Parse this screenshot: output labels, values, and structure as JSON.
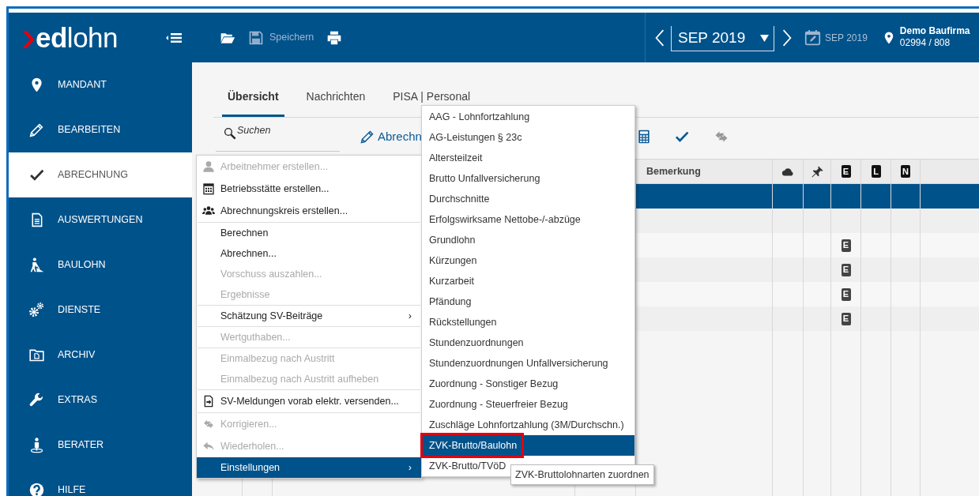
{
  "app": {
    "logo": "**ed**lohn"
  },
  "toolbar": [
    {
      "disabled": false
    },
    {
      "label": "Speichern",
      "disabled": true
    },
    {
      "disabled": false
    }
  ],
  "period": {
    "month": "SEP 2019",
    "booked": "SEP 2019"
  },
  "client": {
    "name": "Demo Baufirma",
    "number": "02994 / 808"
  },
  "sidebar": {
    "items": [
      {
        "label": "MANDANT",
        "selected": false
      },
      {
        "label": "BEARBEITEN",
        "selected": false
      },
      {
        "label": "ABRECHNUNG",
        "selected": true
      },
      {
        "label": "AUSWERTUNGEN",
        "selected": false
      },
      {
        "label": "BAULOHN",
        "selected": false
      },
      {
        "label": "DIENSTE",
        "selected": false
      },
      {
        "label": "ARCHIV",
        "selected": false
      },
      {
        "label": "EXTRAS",
        "selected": false
      },
      {
        "label": "BERATER",
        "selected": false
      },
      {
        "label": "HILFE",
        "selected": false
      }
    ]
  },
  "tabs": [
    {
      "label": "Übersicht",
      "selected": true
    },
    {
      "label": "Nachrichten",
      "selected": false
    },
    {
      "label": "PISA | Personal",
      "selected": false
    }
  ],
  "search": {
    "placeholder": "Suchen"
  },
  "actions": [
    {
      "label": "Abrechn",
      "disabled": false
    },
    {
      "disabled": false
    },
    {
      "disabled": false
    },
    {
      "disabled": true
    }
  ],
  "table": {
    "columns": [
      {
        "kind": "text",
        "label": "Bemerkung"
      },
      {
        "kind": "icon"
      },
      {
        "kind": "icon"
      },
      {
        "kind": "badge",
        "label": "E"
      },
      {
        "kind": "badge",
        "label": "L"
      },
      {
        "kind": "badge",
        "label": "N"
      }
    ],
    "rows": [
      {
        "selected": true
      },
      {
        "selected": false
      },
      {
        "selected": false,
        "badge": "E"
      },
      {
        "selected": false,
        "badge": "E"
      },
      {
        "selected": false,
        "badge": "E"
      },
      {
        "selected": false,
        "badge": "E"
      }
    ]
  },
  "context_menu": {
    "groups": [
      [
        {
          "label": "Arbeitnehmer erstellen...",
          "disabled": true,
          "selected": false
        },
        {
          "label": "Betriebsstätte erstellen...",
          "disabled": false,
          "selected": false
        },
        {
          "label": "Abrechnungskreis erstellen...",
          "disabled": false,
          "selected": false
        }
      ],
      [
        {
          "label": "Berechnen",
          "disabled": false,
          "selected": false
        },
        {
          "label": "Abrechnen...",
          "disabled": false,
          "selected": false
        },
        {
          "label": "Vorschuss auszahlen...",
          "disabled": true,
          "selected": false
        },
        {
          "label": "Ergebnisse",
          "disabled": true,
          "selected": false
        }
      ],
      [
        {
          "label": "Schätzung SV-Beiträge",
          "disabled": false,
          "selected": false,
          "arrow": "›"
        }
      ],
      [
        {
          "label": "Wertguthaben...",
          "disabled": true,
          "selected": false
        }
      ],
      [
        {
          "label": "Einmalbezug nach Austritt",
          "disabled": true,
          "selected": false
        },
        {
          "label": "Einmalbezug nach Austritt aufheben",
          "disabled": true,
          "selected": false
        }
      ],
      [
        {
          "label": "SV-Meldungen vorab elektr. versenden...",
          "disabled": false,
          "selected": false
        }
      ],
      [
        {
          "label": "Korrigieren...",
          "disabled": true,
          "selected": false
        },
        {
          "label": "Wiederholen...",
          "disabled": true,
          "selected": false
        },
        {
          "label": "Einstellungen",
          "disabled": false,
          "selected": true,
          "arrow": "›"
        }
      ]
    ]
  },
  "submenu": {
    "items": [
      {
        "label": "AAG - Lohnfortzahlung",
        "selected": false
      },
      {
        "label": "AG-Leistungen § 23c",
        "selected": false
      },
      {
        "label": "Altersteilzeit",
        "selected": false
      },
      {
        "label": "Brutto Unfallversicherung",
        "selected": false
      },
      {
        "label": "Durchschnitte",
        "selected": false
      },
      {
        "label": "Erfolgswirksame Nettobe-/-abzüge",
        "selected": false
      },
      {
        "label": "Grundlohn",
        "selected": false
      },
      {
        "label": "Kürzungen",
        "selected": false
      },
      {
        "label": "Kurzarbeit",
        "selected": false
      },
      {
        "label": "Pfändung",
        "selected": false
      },
      {
        "label": "Rückstellungen",
        "selected": false
      },
      {
        "label": "Stundenzuordnungen",
        "selected": false
      },
      {
        "label": "Stundenzuordnungen Unfallversicherung",
        "selected": false
      },
      {
        "label": "Zuordnung - Sonstiger Bezug",
        "selected": false
      },
      {
        "label": "Zuordnung - Steuerfreier Bezug",
        "selected": false
      },
      {
        "label": "Zuschläge Lohnfortzahlung (3M/Durchschn.)",
        "selected": false
      },
      {
        "label": "ZVK-Brutto/Baulohn",
        "selected": true,
        "highlighted": true
      },
      {
        "label": "ZVK-Brutto/TVöD",
        "selected": false
      }
    ]
  },
  "tooltip": "ZVK-Bruttolohnarten zuordnen"
}
